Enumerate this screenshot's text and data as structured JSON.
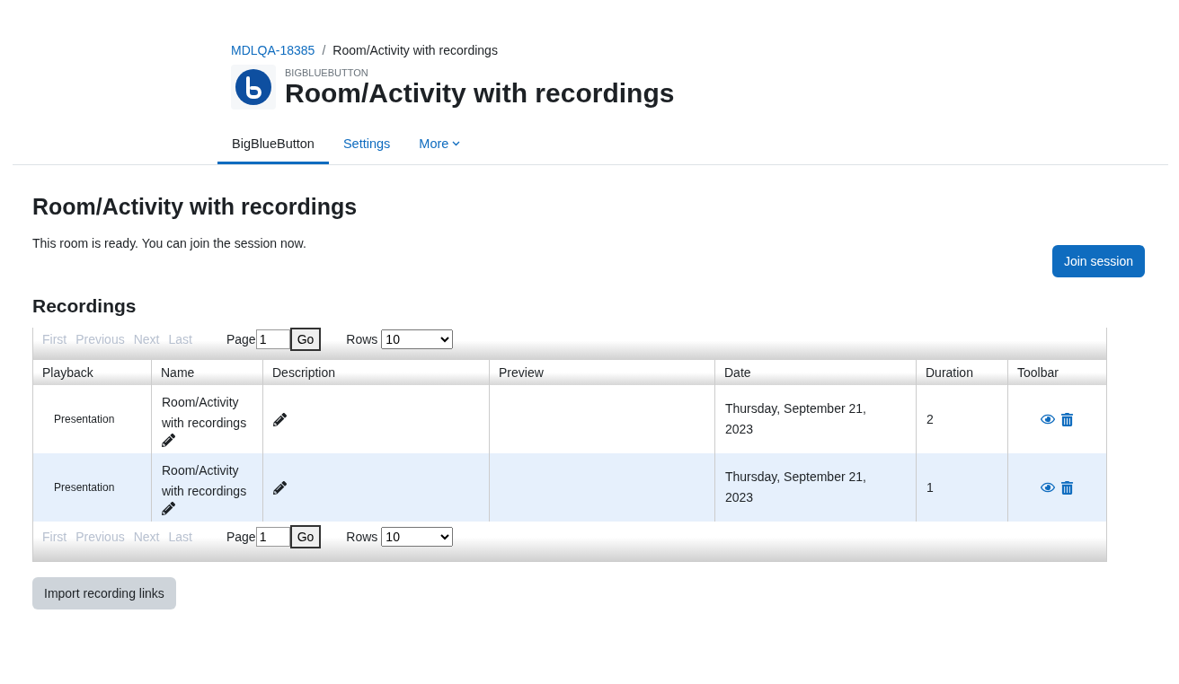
{
  "breadcrumb_separator": "/",
  "breadcrumb": [
    {
      "label": "MDLQA-18385",
      "link": true
    },
    {
      "label": "Room/Activity with recordings",
      "link": false
    }
  ],
  "header": {
    "module": "BIGBLUEBUTTON",
    "title": "Room/Activity with recordings"
  },
  "tabs": [
    {
      "label": "BigBlueButton",
      "selected": true,
      "dropdown": false
    },
    {
      "label": "Settings",
      "selected": false,
      "dropdown": false
    },
    {
      "label": "More",
      "selected": false,
      "dropdown": true
    }
  ],
  "heading": "Room/Activity with recordings",
  "status_text": "This room is ready. You can join the session now.",
  "join_button": "Join session",
  "recordings_heading": "Recordings",
  "pager_top": {
    "links": [
      {
        "label": "First",
        "disabled": true
      },
      {
        "label": "Previous",
        "disabled": true
      },
      {
        "label": "Next",
        "disabled": true
      },
      {
        "label": "Last",
        "disabled": true
      }
    ],
    "page_label": "Page",
    "page": "1",
    "go": "Go",
    "rows_label": "Rows",
    "rows": "10"
  },
  "table": {
    "columns": [
      "Playback",
      "Name",
      "Description",
      "Preview",
      "Date",
      "Duration",
      "Toolbar"
    ],
    "rows": [
      {
        "playback": "Presentation",
        "name": "Room/Activity with recordings",
        "date": "Thursday, September 21, 2023",
        "duration": "2",
        "highlighted": false
      },
      {
        "playback": "Presentation",
        "name": "Room/Activity with recordings",
        "date": "Thursday, September 21, 2023",
        "duration": "1",
        "highlighted": true
      }
    ]
  },
  "pager_bottom": {
    "links": [
      {
        "label": "First",
        "disabled": true
      },
      {
        "label": "Previous",
        "disabled": true
      },
      {
        "label": "Next",
        "disabled": true
      },
      {
        "label": "Last",
        "disabled": true
      }
    ],
    "page_label": "Page",
    "page": "1",
    "go": "Go",
    "rows_label": "Rows",
    "rows": "10"
  },
  "import_button": "Import recording links"
}
